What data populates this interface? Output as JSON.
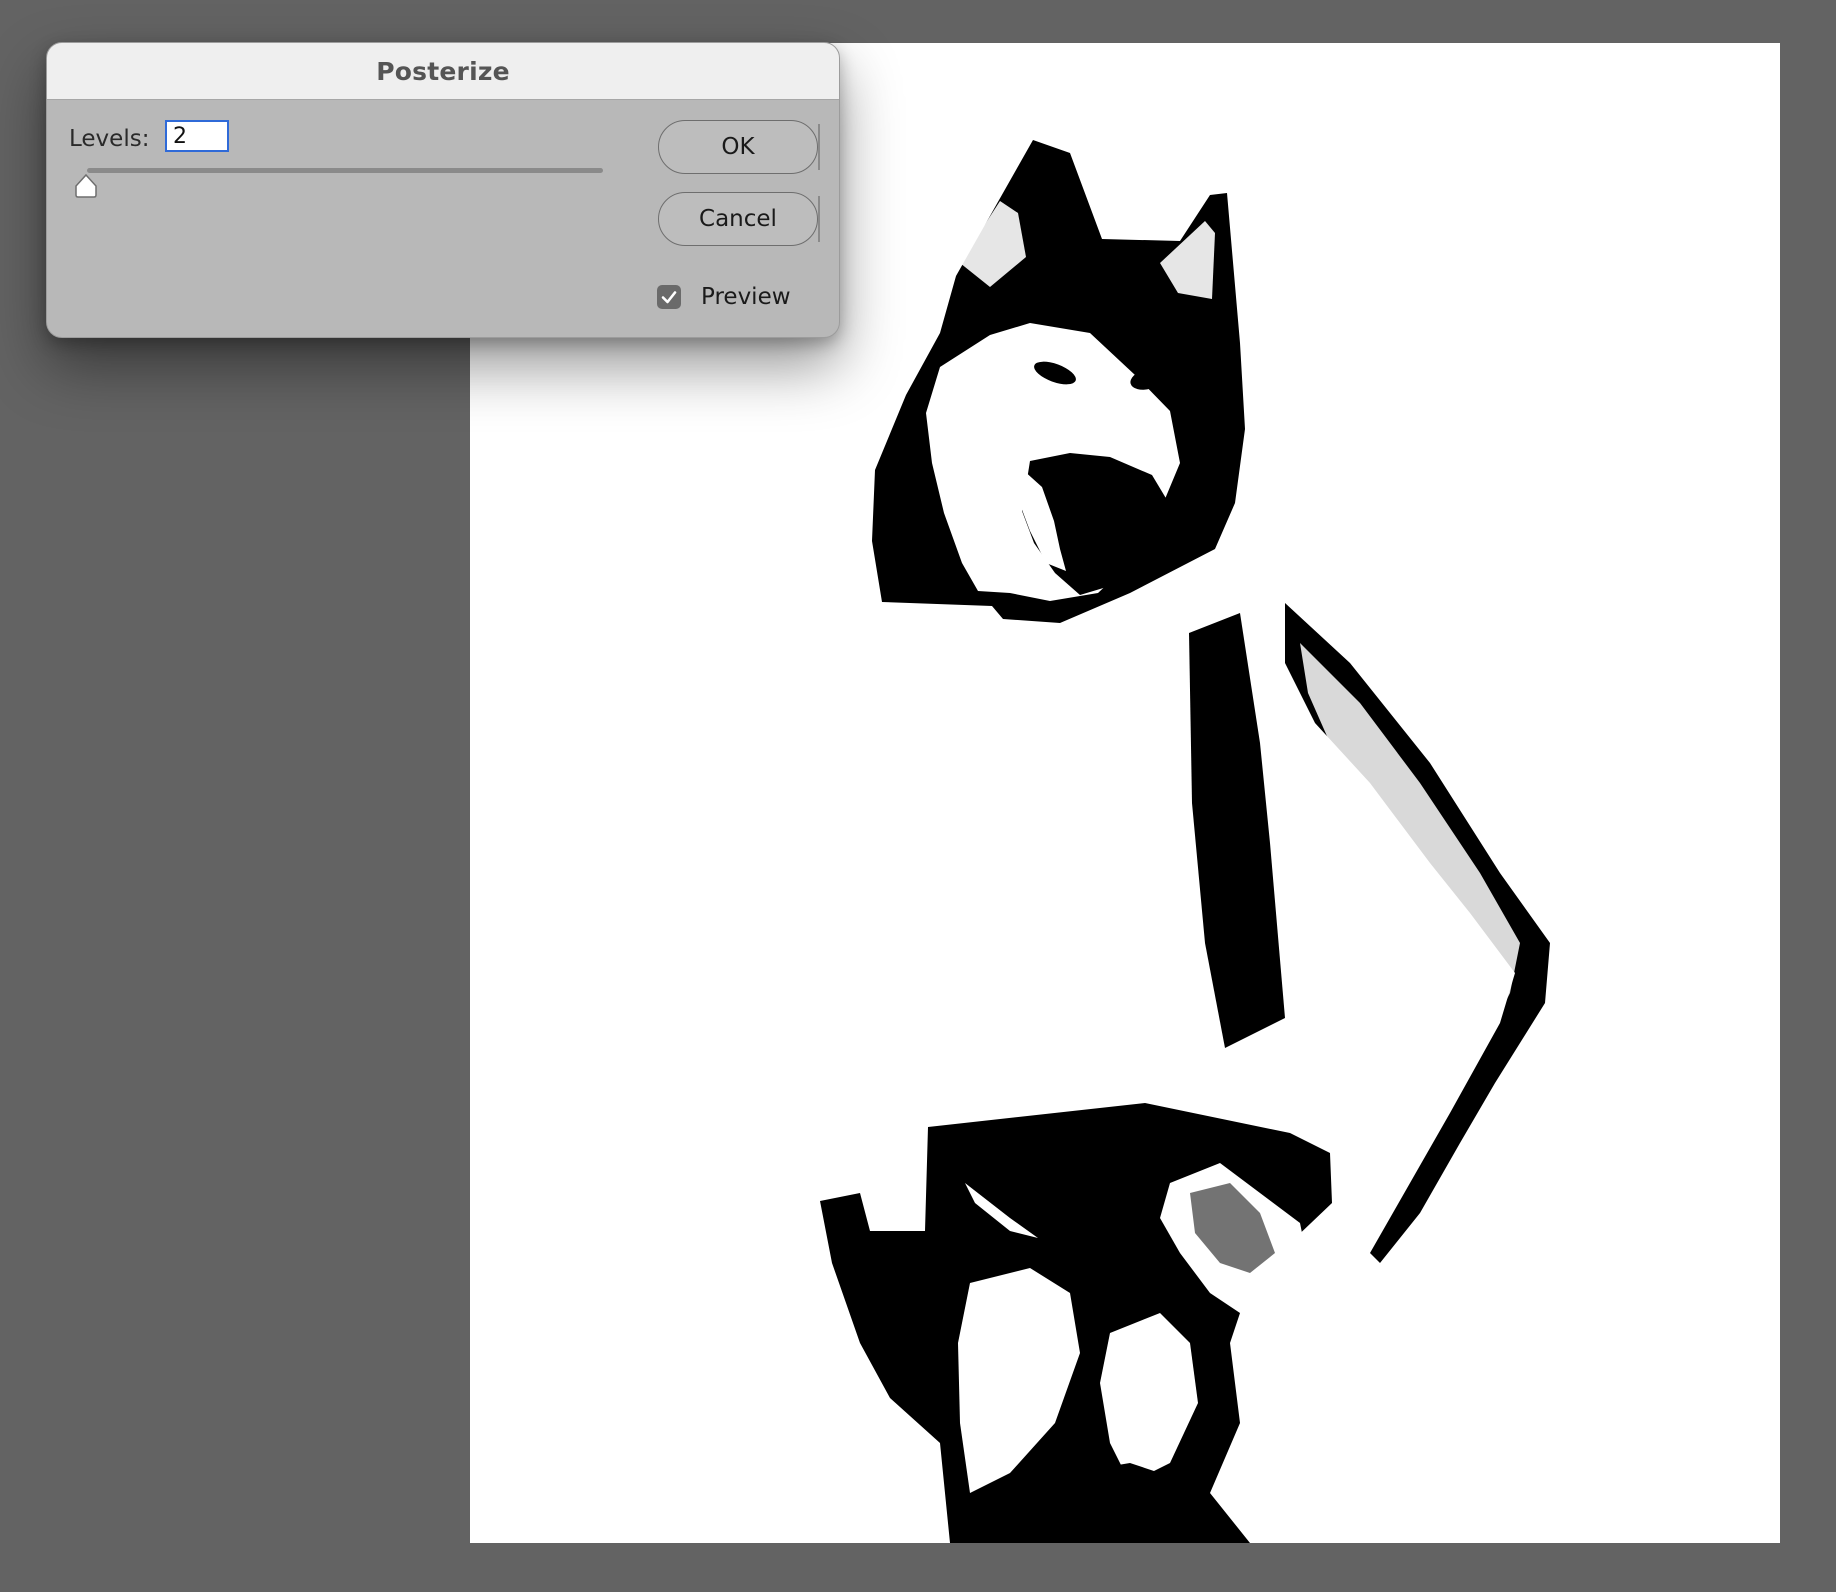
{
  "dialog": {
    "title": "Posterize",
    "levels_label": "Levels:",
    "levels_value": "2",
    "levels_slider_value": 2,
    "ok_label": "OK",
    "cancel_label": "Cancel",
    "preview_label": "Preview",
    "preview_checked": true
  },
  "colors": {
    "workspace_bg": "#636363",
    "dialog_bg": "#b8b8b8",
    "titlebar_bg": "#efefef",
    "input_focus": "#2f6ad8",
    "canvas_bg": "#ffffff",
    "image_ink": "#000000"
  },
  "canvas": {
    "image": "posterized-husky-figure"
  }
}
